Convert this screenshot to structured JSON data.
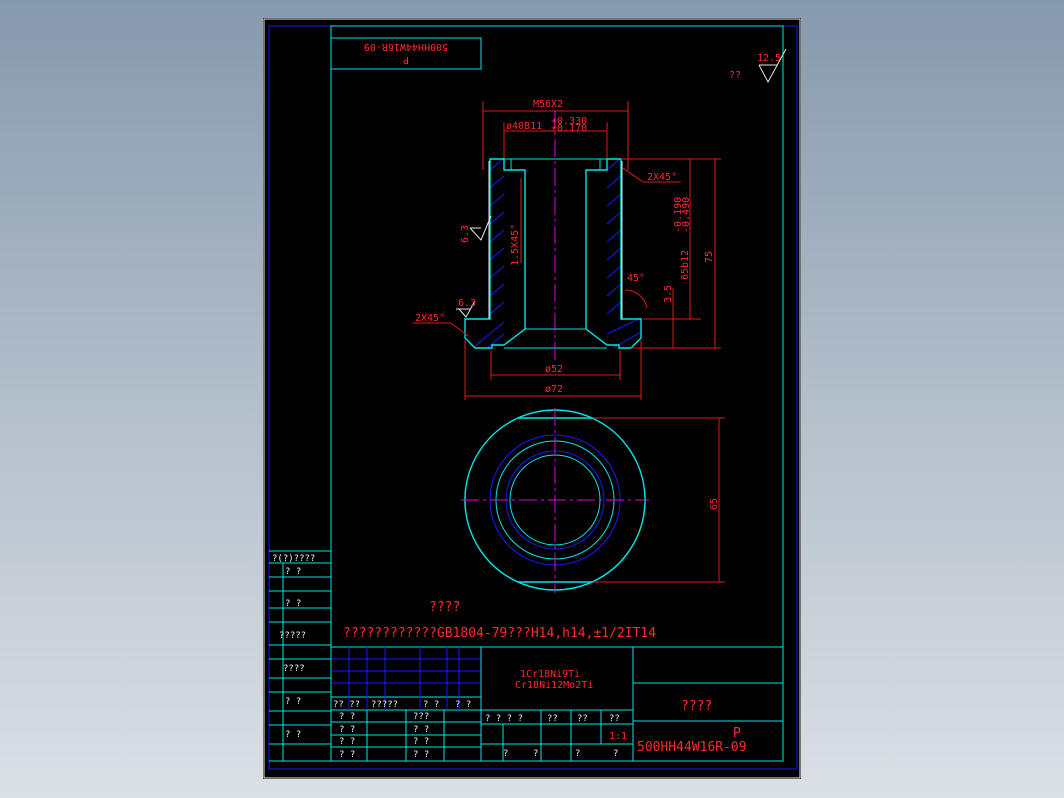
{
  "drawing": {
    "title_box_mirrored": {
      "line1": "P",
      "line2": "500HH44W16R-09"
    },
    "roughness_general": {
      "value": "12.5",
      "mark": "??"
    },
    "dimensions": {
      "thread": "M56X2",
      "bore": "ø40B11",
      "bore_tol_upper": "+0.330",
      "bore_tol_lower": "+0.170",
      "chamfer_top": "2X45°",
      "chamfer_bottom": "2X45°",
      "inner_chamfer": "1.5X45°",
      "shaft_dia": "65b12",
      "shaft_tol_upper": "-0.190",
      "shaft_tol_lower": "-0.490",
      "height": "75",
      "flange_angle": "45°",
      "flange_height": "3.5",
      "dia_52": "ø52",
      "dia_72": "ø72",
      "across_flats": "65",
      "roughness_a": "6.3",
      "roughness_b": "6.3"
    },
    "notes": {
      "heading": "????",
      "line": "????????????GB1804-79???H14,h14,±1/2IT14"
    },
    "left_column": [
      "?(?)????",
      "?  ?",
      "?  ?",
      "?????",
      "????",
      "?  ?",
      "?  ?"
    ],
    "title_block": {
      "material_1": "1Cr18Ni9Ti",
      "material_2": "Cr18Ni12Mo2Ti",
      "name": "????",
      "code_1": "P",
      "code_2": "500HH44W16R-09",
      "scale": "1:1",
      "row_labels": [
        "?? ??",
        "?????",
        "?  ?",
        "?  ?",
        "?  ?",
        "?  ?"
      ],
      "col_labels": [
        "???",
        "?  ?",
        "?  ?",
        "?  ?  ?  ?",
        "??",
        "??",
        "??",
        "?",
        "?",
        "?",
        "?"
      ],
      "sign_marks": [
        "?",
        "?"
      ]
    }
  }
}
